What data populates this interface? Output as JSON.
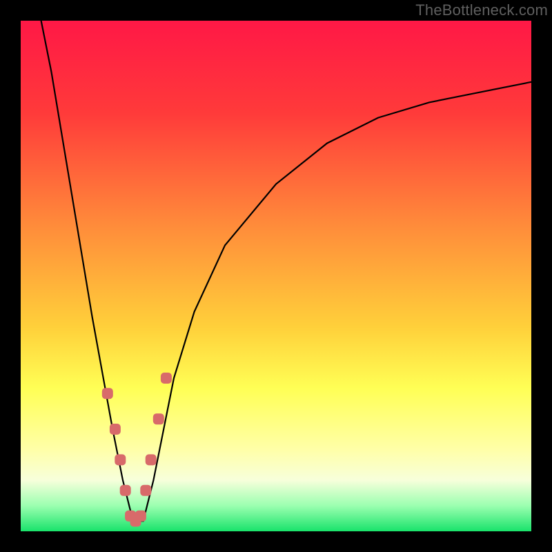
{
  "watermark": "TheBottleneck.com",
  "colors": {
    "frame": "#000000",
    "gradient_stops": [
      {
        "pct": 0,
        "color": "#ff1846"
      },
      {
        "pct": 18,
        "color": "#ff3a3a"
      },
      {
        "pct": 40,
        "color": "#ff8b3a"
      },
      {
        "pct": 60,
        "color": "#ffd03a"
      },
      {
        "pct": 72,
        "color": "#ffff55"
      },
      {
        "pct": 84,
        "color": "#ffffa8"
      },
      {
        "pct": 90,
        "color": "#f7ffdb"
      },
      {
        "pct": 95,
        "color": "#9bffb0"
      },
      {
        "pct": 100,
        "color": "#19e36b"
      }
    ],
    "curve": "#000000",
    "marker": "#d86a6a"
  },
  "chart_data": {
    "type": "line",
    "title": "",
    "xlabel": "",
    "ylabel": "",
    "xlim": [
      0,
      100
    ],
    "ylim": [
      0,
      100
    ],
    "note": "Y-axis is inverted visually: 0 = bottom (green/good), 100 = top (red/bad). Curve depicts bottleneck percentage; it drops to ~0 near x≈22 then rises asymptotically.",
    "series": [
      {
        "name": "bottleneck-curve",
        "x": [
          4,
          6,
          8,
          10,
          12,
          14,
          16,
          18,
          20,
          22,
          24,
          26,
          28,
          30,
          34,
          40,
          50,
          60,
          70,
          80,
          90,
          100
        ],
        "values": [
          100,
          90,
          78,
          66,
          54,
          42,
          31,
          20,
          10,
          2,
          2,
          10,
          20,
          30,
          43,
          56,
          68,
          76,
          81,
          84,
          86,
          88
        ]
      }
    ],
    "markers": {
      "name": "sample-points",
      "x": [
        17,
        18.5,
        19.5,
        20.5,
        21.5,
        22.5,
        23.5,
        24.5,
        25.5,
        27,
        28.5
      ],
      "values": [
        27,
        20,
        14,
        8,
        3,
        2,
        3,
        8,
        14,
        22,
        30
      ]
    }
  }
}
